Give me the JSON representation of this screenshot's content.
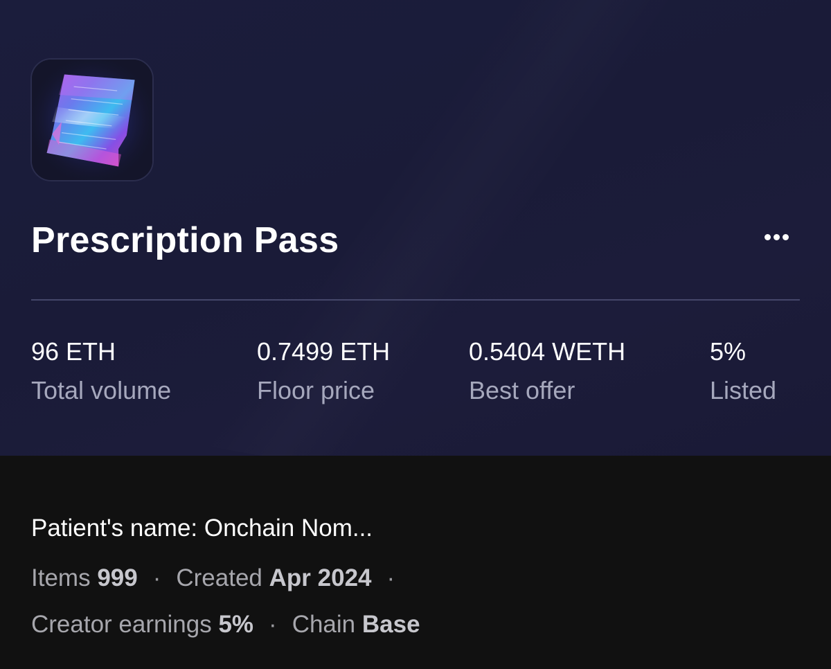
{
  "collection": {
    "name": "Prescription Pass",
    "image_icon": "prescription-paper-icon"
  },
  "actions": {
    "more_icon": "ellipsis-icon"
  },
  "stats": [
    {
      "value": "96 ETH",
      "label": "Total volume"
    },
    {
      "value": "0.7499 ETH",
      "label": "Floor price"
    },
    {
      "value": "0.5404 WETH",
      "label": "Best offer"
    },
    {
      "value": "5%",
      "label": "Listed"
    }
  ],
  "details": {
    "description": "Patient's name: Onchain Nom...",
    "items_label": "Items",
    "items_value": "999",
    "created_label": "Created",
    "created_value": "Apr 2024",
    "earnings_label": "Creator earnings",
    "earnings_value": "5%",
    "chain_label": "Chain",
    "chain_value": "Base",
    "separator": "·"
  },
  "colors": {
    "hero_background": "#1b1c3a",
    "page_background": "#111111",
    "text_primary": "#ffffff",
    "text_secondary": "#a6a8bd",
    "divider": "#45476a"
  }
}
